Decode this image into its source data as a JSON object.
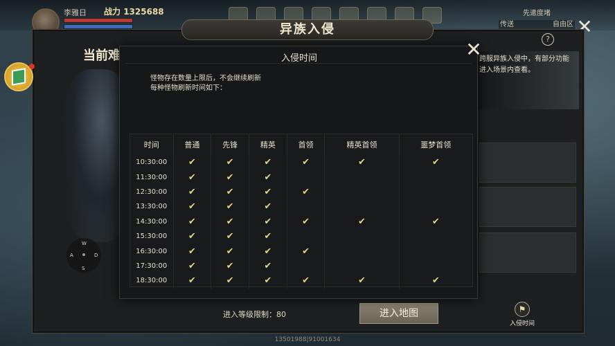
{
  "hud": {
    "name": "李雅日",
    "power": "1325688",
    "power_label": "战力",
    "hp_fraction": 1.0,
    "mp_fraction": 1.0,
    "server_top": "先遣度堵",
    "server_left": "传送",
    "server_right": "自由区",
    "bottom_id": "13501988|91001634"
  },
  "panel": {
    "title": "异族入侵",
    "difficulty_label": "当前难",
    "info_text": "跨服异族入侵中，有部分功能进入场景内查看。",
    "level_limit_label": "进入等级限制：80",
    "enter_map_label": "进入地图",
    "invasion_time_label": "入侵时间",
    "help_label": "?"
  },
  "wasd": {
    "w": "W",
    "a": "A",
    "s": "S",
    "d": "D"
  },
  "popup": {
    "title": "入侵时间",
    "desc_lines": [
      "怪物存在数量上限后，不会继续刷新",
      "每种怪物刷新时间如下："
    ],
    "headers": [
      "时间",
      "普通",
      "先锋",
      "精英",
      "首领",
      "精英首领",
      "噩梦首领"
    ],
    "rows": [
      {
        "time": "10:30:00",
        "flags": [
          1,
          1,
          1,
          1,
          1,
          1
        ]
      },
      {
        "time": "11:30:00",
        "flags": [
          1,
          1,
          1,
          0,
          0,
          0
        ]
      },
      {
        "time": "12:30:00",
        "flags": [
          1,
          1,
          1,
          1,
          0,
          0
        ]
      },
      {
        "time": "13:30:00",
        "flags": [
          1,
          1,
          1,
          0,
          0,
          0
        ]
      },
      {
        "time": "14:30:00",
        "flags": [
          1,
          1,
          1,
          1,
          1,
          1
        ]
      },
      {
        "time": "15:30:00",
        "flags": [
          1,
          1,
          1,
          0,
          0,
          0
        ]
      },
      {
        "time": "16:30:00",
        "flags": [
          1,
          1,
          1,
          1,
          0,
          0
        ]
      },
      {
        "time": "17:30:00",
        "flags": [
          1,
          1,
          1,
          0,
          0,
          0
        ]
      },
      {
        "time": "18:30:00",
        "flags": [
          1,
          1,
          1,
          1,
          1,
          1
        ]
      }
    ],
    "check_glyph": "✔"
  },
  "icons": {
    "close": "close-icon",
    "check": "check-icon",
    "flag": "flag-icon"
  }
}
